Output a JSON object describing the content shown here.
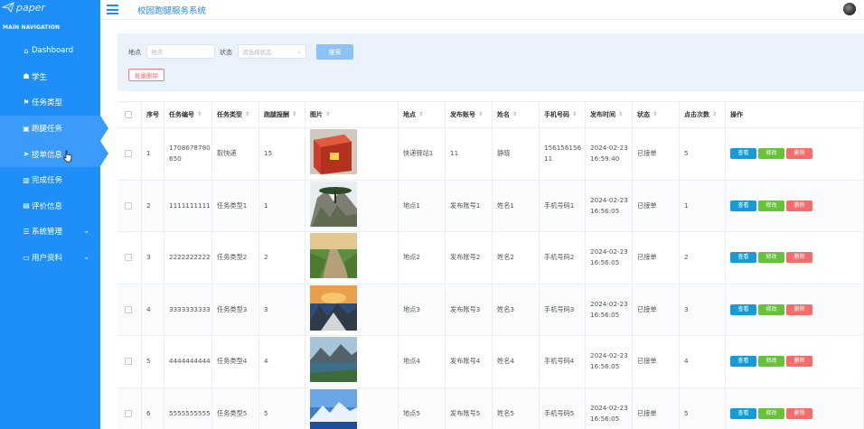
{
  "brand": {
    "name": "paper"
  },
  "nav": {
    "header": "MAIN NAVIGATION",
    "items": [
      {
        "icon": "home-icon",
        "glyph": "⌂",
        "label": "Dashboard"
      },
      {
        "icon": "student-icon",
        "glyph": "☗",
        "label": "学生"
      },
      {
        "icon": "task-type-icon",
        "glyph": "⚑",
        "label": "任务类型"
      },
      {
        "icon": "errand-task-icon",
        "glyph": "▣",
        "label": "跑腿任务"
      },
      {
        "icon": "send-icon",
        "glyph": "➤",
        "label": "接单信息"
      },
      {
        "icon": "done-task-icon",
        "glyph": "▥",
        "label": "完成任务"
      },
      {
        "icon": "review-icon",
        "glyph": "▤",
        "label": "评价信息"
      },
      {
        "icon": "settings-icon",
        "glyph": "☰",
        "label": "系统管理",
        "chevron": "⌄"
      },
      {
        "icon": "user-profile-icon",
        "glyph": "▭",
        "label": "用户资料",
        "chevron": "⌄"
      }
    ]
  },
  "topbar": {
    "title": "校园跑腿服务系统"
  },
  "search": {
    "location_label": "地点",
    "location_placeholder": "地点",
    "status_label": "状态",
    "status_placeholder": "请选择状态",
    "search_button": "搜索",
    "batch_delete": "批量删除"
  },
  "table": {
    "headers": [
      "序号",
      "任务编号",
      "任务类型",
      "跑腿报酬",
      "图片",
      "地点",
      "发布账号",
      "姓名",
      "手机号码",
      "发布时间",
      "状态",
      "点击次数",
      "操作"
    ],
    "action_labels": {
      "view": "查看",
      "edit": "修改",
      "delete": "删除"
    },
    "rows": [
      {
        "no": "1",
        "task_no": "1708678780650",
        "type": "取快递",
        "reward": "15",
        "image": "parcel-box",
        "location": "快递驿站1",
        "account": "11",
        "name": "静晓",
        "phone": "15615615611",
        "time": "2024-02-23 16:59:40",
        "status": "已接单",
        "clicks": "5"
      },
      {
        "no": "2",
        "task_no": "1111111111",
        "type": "任务类型1",
        "reward": "1",
        "image": "rock-pine",
        "location": "地点1",
        "account": "发布账号1",
        "name": "姓名1",
        "phone": "手机号码1",
        "time": "2024-02-23 16:56:05",
        "status": "已接单",
        "clicks": "1"
      },
      {
        "no": "3",
        "task_no": "2222222222",
        "type": "任务类型2",
        "reward": "2",
        "image": "grass-path",
        "location": "地点2",
        "account": "发布账号2",
        "name": "姓名2",
        "phone": "手机号码2",
        "time": "2024-02-23 16:56:05",
        "status": "已接单",
        "clicks": "2"
      },
      {
        "no": "4",
        "task_no": "3333333333",
        "type": "任务类型3",
        "reward": "3",
        "image": "sunset-mountain",
        "location": "地点3",
        "account": "发布账号3",
        "name": "姓名3",
        "phone": "手机号码3",
        "time": "2024-02-23 16:56:05",
        "status": "已接单",
        "clicks": "3"
      },
      {
        "no": "5",
        "task_no": "4444444444",
        "type": "任务类型4",
        "reward": "4",
        "image": "mountain-lake",
        "location": "地点4",
        "account": "发布账号4",
        "name": "姓名4",
        "phone": "手机号码4",
        "time": "2024-02-23 16:56:05",
        "status": "已接单",
        "clicks": "4"
      },
      {
        "no": "6",
        "task_no": "5555555555",
        "type": "任务类型5",
        "reward": "5",
        "image": "blue-mountain",
        "location": "地点5",
        "account": "发布账号5",
        "name": "姓名5",
        "phone": "手机号码5",
        "time": "2024-02-23 16:56:05",
        "status": "已接单",
        "clicks": "5"
      }
    ]
  },
  "colors": {
    "sidebar": "#1e8ff8",
    "accent": "#1e8ff8",
    "view": "#169bd5",
    "edit": "#67c23a",
    "delete": "#f56c6c"
  }
}
